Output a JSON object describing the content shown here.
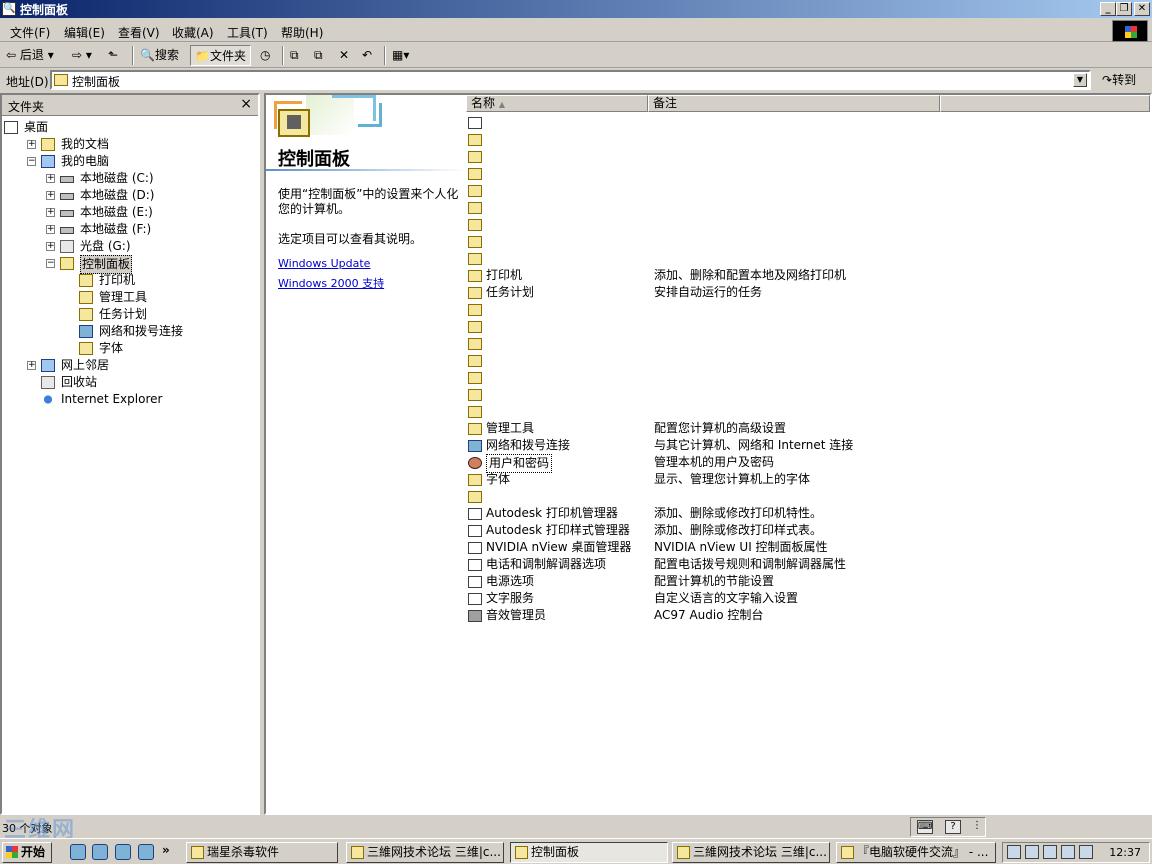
{
  "window": {
    "title": "控制面板",
    "icon": "search-folder-icon",
    "controls": [
      "minimize",
      "restore",
      "close"
    ]
  },
  "menu": [
    "文件(F)",
    "编辑(E)",
    "查看(V)",
    "收藏(A)",
    "工具(T)",
    "帮助(H)"
  ],
  "toolbar": {
    "back_label": "后退",
    "search_label": "搜索",
    "folders_label": "文件夹"
  },
  "address": {
    "label": "地址(D)",
    "value": "控制面板",
    "go_label": "转到"
  },
  "folders_panel": {
    "title": "文件夹",
    "close_glyph": "×",
    "tree": [
      {
        "label": "桌面",
        "icon": "desktop-icon"
      },
      {
        "label": "我的文档",
        "icon": "folder-icon",
        "expander": "+"
      },
      {
        "label": "我的电脑",
        "icon": "computer-icon",
        "expander": "−"
      },
      {
        "label": "本地磁盘 (C:)",
        "icon": "drive-icon",
        "expander": "+"
      },
      {
        "label": "本地磁盘 (D:)",
        "icon": "drive-icon",
        "expander": "+"
      },
      {
        "label": "本地磁盘 (E:)",
        "icon": "drive-icon",
        "expander": "+"
      },
      {
        "label": "本地磁盘 (F:)",
        "icon": "drive-icon",
        "expander": "+"
      },
      {
        "label": "光盘 (G:)",
        "icon": "cd-drive-icon",
        "expander": "+"
      },
      {
        "label": "控制面板",
        "icon": "control-panel-icon",
        "expander": "−",
        "selected": true
      },
      {
        "label": "打印机",
        "icon": "printer-folder-icon"
      },
      {
        "label": "管理工具",
        "icon": "admin-tools-icon"
      },
      {
        "label": "任务计划",
        "icon": "scheduled-tasks-icon"
      },
      {
        "label": "网络和拨号连接",
        "icon": "network-icon"
      },
      {
        "label": "字体",
        "icon": "fonts-icon"
      },
      {
        "label": "网上邻居",
        "icon": "network-places-icon",
        "expander": "+"
      },
      {
        "label": "回收站",
        "icon": "recycle-bin-icon"
      },
      {
        "label": "Internet Explorer",
        "icon": "ie-icon"
      }
    ]
  },
  "web_view": {
    "title": "控制面板",
    "description": "使用“控制面板”中的设置来个人化您的计算机。",
    "hint": "选定项目可以查看其说明。",
    "links": [
      "Windows Update",
      "Windows 2000 支持"
    ]
  },
  "columns": {
    "name": "名称",
    "comment": "备注",
    "sort_glyph": "▲"
  },
  "items": [
    {
      "name": "",
      "comment": "",
      "icon": "applet-icon"
    },
    {
      "name": "",
      "comment": "",
      "icon": "folder-icon"
    },
    {
      "name": "",
      "comment": "",
      "icon": "folder-icon"
    },
    {
      "name": "",
      "comment": "",
      "icon": "folder-icon"
    },
    {
      "name": "",
      "comment": "",
      "icon": "folder-icon"
    },
    {
      "name": "",
      "comment": "",
      "icon": "folder-icon"
    },
    {
      "name": "",
      "comment": "",
      "icon": "folder-icon"
    },
    {
      "name": "",
      "comment": "",
      "icon": "folder-icon"
    },
    {
      "name": "",
      "comment": "",
      "icon": "folder-icon"
    },
    {
      "name": "打印机",
      "comment": "添加、删除和配置本地及网络打印机",
      "icon": "printer-icon"
    },
    {
      "name": "任务计划",
      "comment": "安排自动运行的任务",
      "icon": "scheduled-tasks-icon"
    },
    {
      "name": "",
      "comment": "",
      "icon": "folder-icon"
    },
    {
      "name": "",
      "comment": "",
      "icon": "folder-icon"
    },
    {
      "name": "",
      "comment": "",
      "icon": "folder-icon"
    },
    {
      "name": "",
      "comment": "",
      "icon": "folder-icon"
    },
    {
      "name": "",
      "comment": "",
      "icon": "folder-icon"
    },
    {
      "name": "",
      "comment": "",
      "icon": "folder-icon"
    },
    {
      "name": "",
      "comment": "",
      "icon": "folder-icon"
    },
    {
      "name": "管理工具",
      "comment": "配置您计算机的高级设置",
      "icon": "admin-tools-icon"
    },
    {
      "name": "网络和拨号连接",
      "comment": "与其它计算机、网络和 Internet 连接",
      "icon": "network-icon"
    },
    {
      "name": "用户和密码",
      "comment": "管理本机的用户及密码",
      "icon": "users-icon",
      "focused": true
    },
    {
      "name": "字体",
      "comment": "显示、管理您计算机上的字体",
      "icon": "fonts-icon"
    },
    {
      "name": "",
      "comment": "",
      "icon": "folder-icon"
    },
    {
      "name": "Autodesk 打印机管理器",
      "comment": "添加、删除或修改打印机特性。",
      "icon": "applet-icon"
    },
    {
      "name": "Autodesk 打印样式管理器",
      "comment": "添加、删除或修改打印样式表。",
      "icon": "applet-icon"
    },
    {
      "name": "NVIDIA nView 桌面管理器",
      "comment": "NVIDIA nView UI 控制面板属性",
      "icon": "applet-icon"
    },
    {
      "name": "电话和调制解调器选项",
      "comment": "配置电话拨号规则和调制解调器属性",
      "icon": "applet-icon"
    },
    {
      "name": "电源选项",
      "comment": "配置计算机的节能设置",
      "icon": "power-icon"
    },
    {
      "name": "文字服务",
      "comment": "自定义语言的文字输入设置",
      "icon": "text-services-icon"
    },
    {
      "name": "音效管理员",
      "comment": "AC97 Audio 控制台",
      "icon": "audio-icon"
    }
  ],
  "status": {
    "text": "30 个对象"
  },
  "taskbar": {
    "start_label": "开始",
    "overflow_glyph": "»",
    "tasks": [
      "瑞星杀毒软件",
      "三維网技术论坛 三维|c...",
      "控制面板",
      "三維网技术论坛 三维|c...",
      "『电脑软硬件交流』 - ..."
    ],
    "clock": "12:37"
  },
  "watermark": "三维网"
}
